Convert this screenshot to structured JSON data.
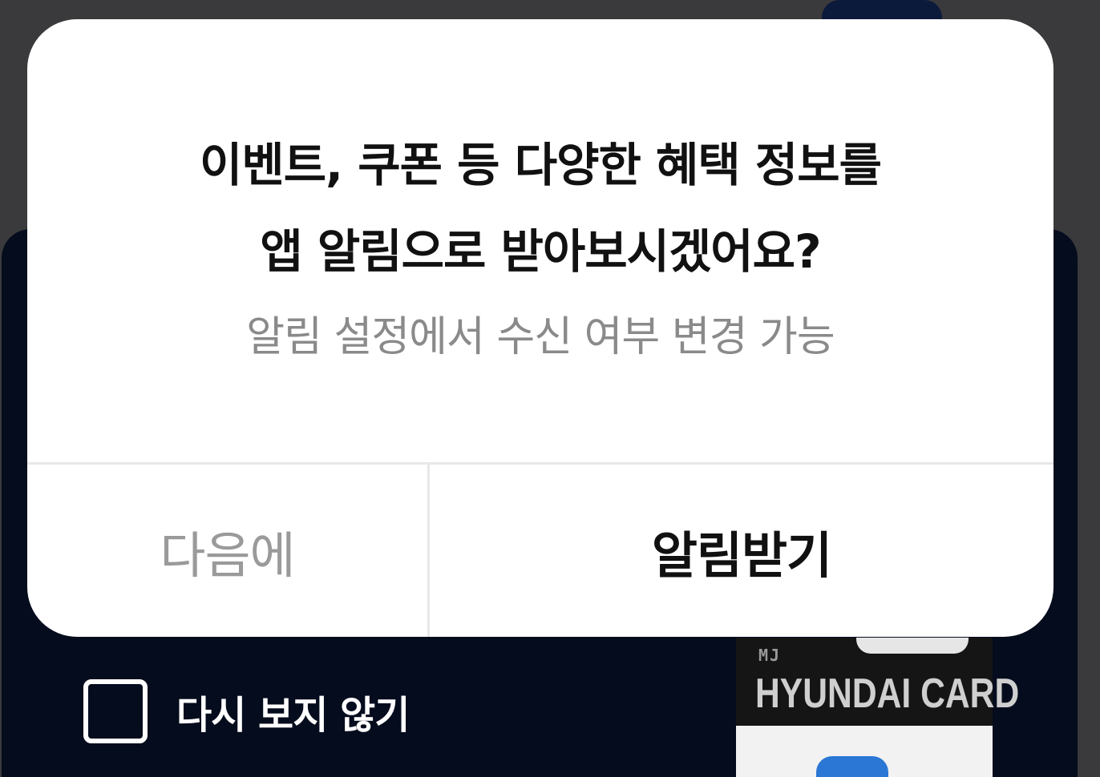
{
  "dialog": {
    "title_line1": "이벤트, 쿠폰 등 다양한 혜택 정보를",
    "title_line2": "앱 알림으로 받아보시겠어요?",
    "subtitle": "알림 설정에서 수신 여부 변경 가능",
    "later_button": "다음에",
    "accept_button": "알림받기"
  },
  "background": {
    "dont_show_label": "다시 보지 않기",
    "dont_show_checked": false,
    "card_logo": "MJ",
    "card_brand": "HYUNDAI CARD"
  },
  "colors": {
    "overlay": "#3a3a3c",
    "panel": "#050c1d",
    "dialog": "#ffffff",
    "title_text": "#111111",
    "subtitle_text": "#8a8a8a",
    "secondary_button_text": "#9a9a9a"
  }
}
